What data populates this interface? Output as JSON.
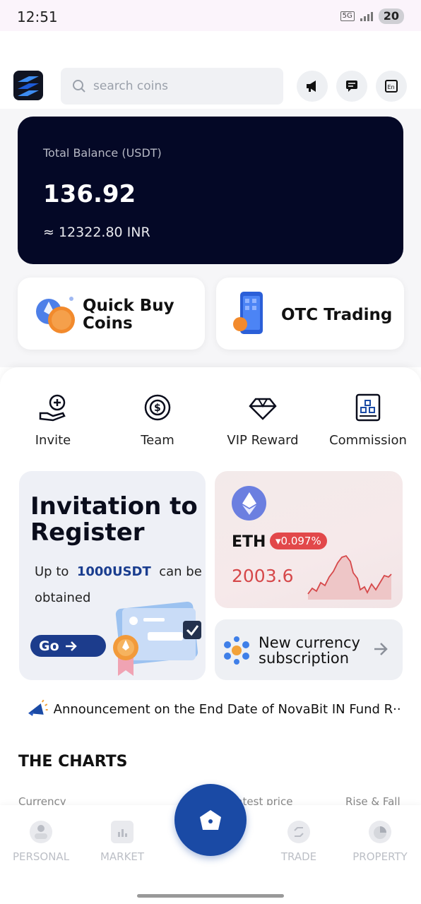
{
  "status_bar": {
    "time": "12:51",
    "network": "5G",
    "battery": "20"
  },
  "header": {
    "search_placeholder": "search coins"
  },
  "balance": {
    "label": "Total Balance (USDT)",
    "value": "136.92",
    "inr": "≈ 12322.80 INR"
  },
  "quick_actions": [
    {
      "label_line1": "Quick Buy",
      "label_line2": "Coins"
    },
    {
      "label": "OTC Trading"
    }
  ],
  "menu": [
    {
      "label": "Invite",
      "icon": "invite-icon"
    },
    {
      "label": "Team",
      "icon": "team-icon"
    },
    {
      "label": "VIP Reward",
      "icon": "diamond-icon"
    },
    {
      "label": "Commission",
      "icon": "commission-icon"
    }
  ],
  "invite_card": {
    "title": "Invitation to Register",
    "desc_prefix": "Up to",
    "desc_amount": "1000USDT",
    "desc_suffix": "can be obtained",
    "button": "Go"
  },
  "eth_card": {
    "symbol": "ETH",
    "change": "▾0.097%",
    "price": "2003.6",
    "accent": "#d6484a"
  },
  "subscription": {
    "label": "New currency subscription"
  },
  "announcement": {
    "text": "Announcement on the End Date of NovaBit IN Fund R···"
  },
  "charts": {
    "title": "THE CHARTS",
    "columns": [
      "Currency",
      "Latest price",
      "Rise & Fall"
    ]
  },
  "tabs": [
    {
      "label": "PERSONAL",
      "icon": "person-icon"
    },
    {
      "label": "MARKET",
      "icon": "market-icon"
    },
    {
      "label": "TRADE",
      "icon": "trade-icon"
    },
    {
      "label": "PROPERTY",
      "icon": "property-icon"
    }
  ],
  "colors": {
    "primary": "#1a4aa5",
    "balance_bg": "#040826"
  }
}
